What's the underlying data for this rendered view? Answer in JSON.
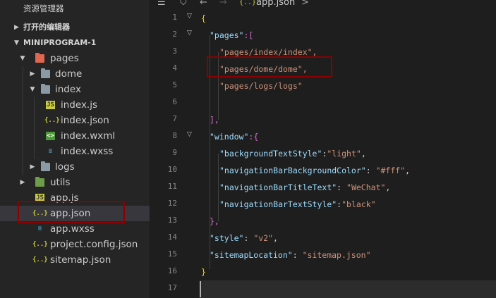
{
  "sidebar": {
    "title": "资源管理器",
    "open_editors": "打开的编辑器",
    "project": "MINIPROGRAM-1",
    "tree": [
      {
        "label": "pages",
        "icon": "folder-open-red-icon"
      },
      {
        "label": "dome",
        "icon": "folder-gray-icon"
      },
      {
        "label": "index",
        "icon": "folder-open-gray-icon"
      },
      {
        "label": "index.js",
        "icon": "js-file-icon"
      },
      {
        "label": "index.json",
        "icon": "json-file-icon"
      },
      {
        "label": "index.wxml",
        "icon": "wxml-file-icon"
      },
      {
        "label": "index.wxss",
        "icon": "css-file-icon"
      },
      {
        "label": "logs",
        "icon": "folder-gray-icon"
      },
      {
        "label": "utils",
        "icon": "folder-green-icon"
      },
      {
        "label": "app.js",
        "icon": "js-file-icon"
      },
      {
        "label": "app.json",
        "icon": "json-file-icon"
      },
      {
        "label": "app.wxss",
        "icon": "css-file-icon"
      },
      {
        "label": "project.config.json",
        "icon": "json-file-icon"
      },
      {
        "label": "sitemap.json",
        "icon": "json-file-icon"
      }
    ],
    "selected": "app.json"
  },
  "editor": {
    "breadcrumb": {
      "json_icon": "{..}",
      "file": "app.json",
      "sep": ">"
    },
    "line_numbers": [
      "1",
      "2",
      "3",
      "4",
      "5",
      "6",
      "7",
      "8",
      "9",
      "10",
      "11",
      "12",
      "13",
      "14",
      "15",
      "16",
      "17"
    ],
    "lines": {
      "l1": "{",
      "l2_key": "\"pages\"",
      "l2_rest": ":[",
      "l3": "\"pages/index/index\",",
      "l4": "\"pages/dome/dome\",",
      "l5": "\"pages/logs/logs\"",
      "l7": "],",
      "l8_key": "\"window\"",
      "l8_rest": ":{",
      "l9_key": "\"backgroundTextStyle\"",
      "l9_sep": ":",
      "l9_val": "\"light\"",
      "l9_end": ",",
      "l10_key": "\"navigationBarBackgroundColor\"",
      "l10_sep": ": ",
      "l10_val": "\"#fff\"",
      "l10_end": ",",
      "l11_key": "\"navigationBarTitleText\"",
      "l11_sep": ": ",
      "l11_val": "\"WeChat\"",
      "l11_end": ",",
      "l12_key": "\"navigationBarTextStyle\"",
      "l12_sep": ":",
      "l12_val": "\"black\"",
      "l13": "},",
      "l14_key": "\"style\"",
      "l14_sep": ": ",
      "l14_val": "\"v2\"",
      "l14_end": ",",
      "l15_key": "\"sitemapLocation\"",
      "l15_sep": ": ",
      "l15_val": "\"sitemap.json\"",
      "l16": "}"
    }
  },
  "colors": {
    "highlight_box": "#8b0000",
    "json_key": "#9cdcfe",
    "json_string": "#ce9178"
  }
}
